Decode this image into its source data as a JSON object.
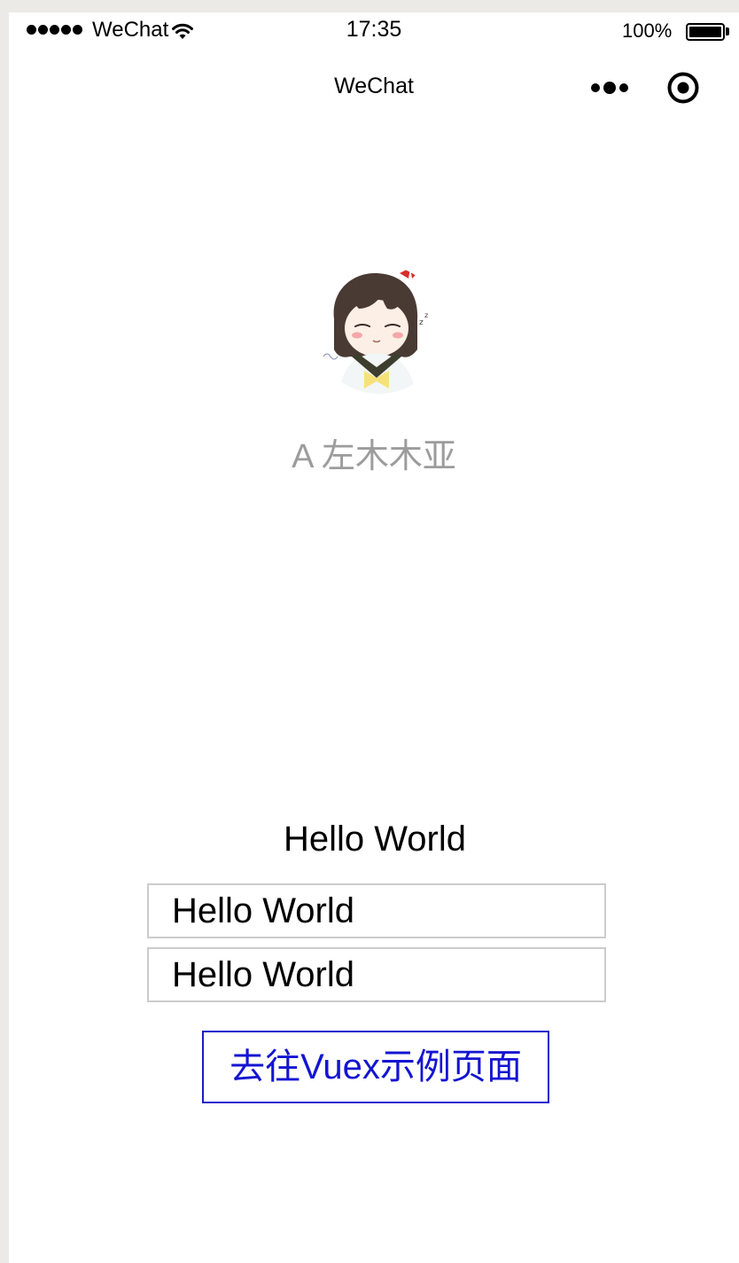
{
  "status_bar": {
    "carrier": "WeChat",
    "time": "17:35",
    "battery_percent": "100%",
    "battery_level": 1.0,
    "signal_icon": "signal-dots-icon",
    "wifi_icon": "wifi-icon",
    "battery_icon": "battery-icon"
  },
  "nav_bar": {
    "title": "WeChat",
    "more_icon": "more-dots-icon",
    "close_icon": "capsule-record-icon"
  },
  "profile": {
    "avatar_icon": "user-avatar-image",
    "nickname": "A 左木木亚"
  },
  "content": {
    "message": "Hello World",
    "input_1_value": "Hello World",
    "input_2_value": "Hello World",
    "vuex_button_label": "去往Vuex示例页面"
  },
  "colors": {
    "page_background": "#FFFFFF",
    "outer_background": "#ECEAE6",
    "nickname_color": "#9C9C9C",
    "input_border": "#CCCCCC",
    "button_accent": "#1414D2"
  }
}
